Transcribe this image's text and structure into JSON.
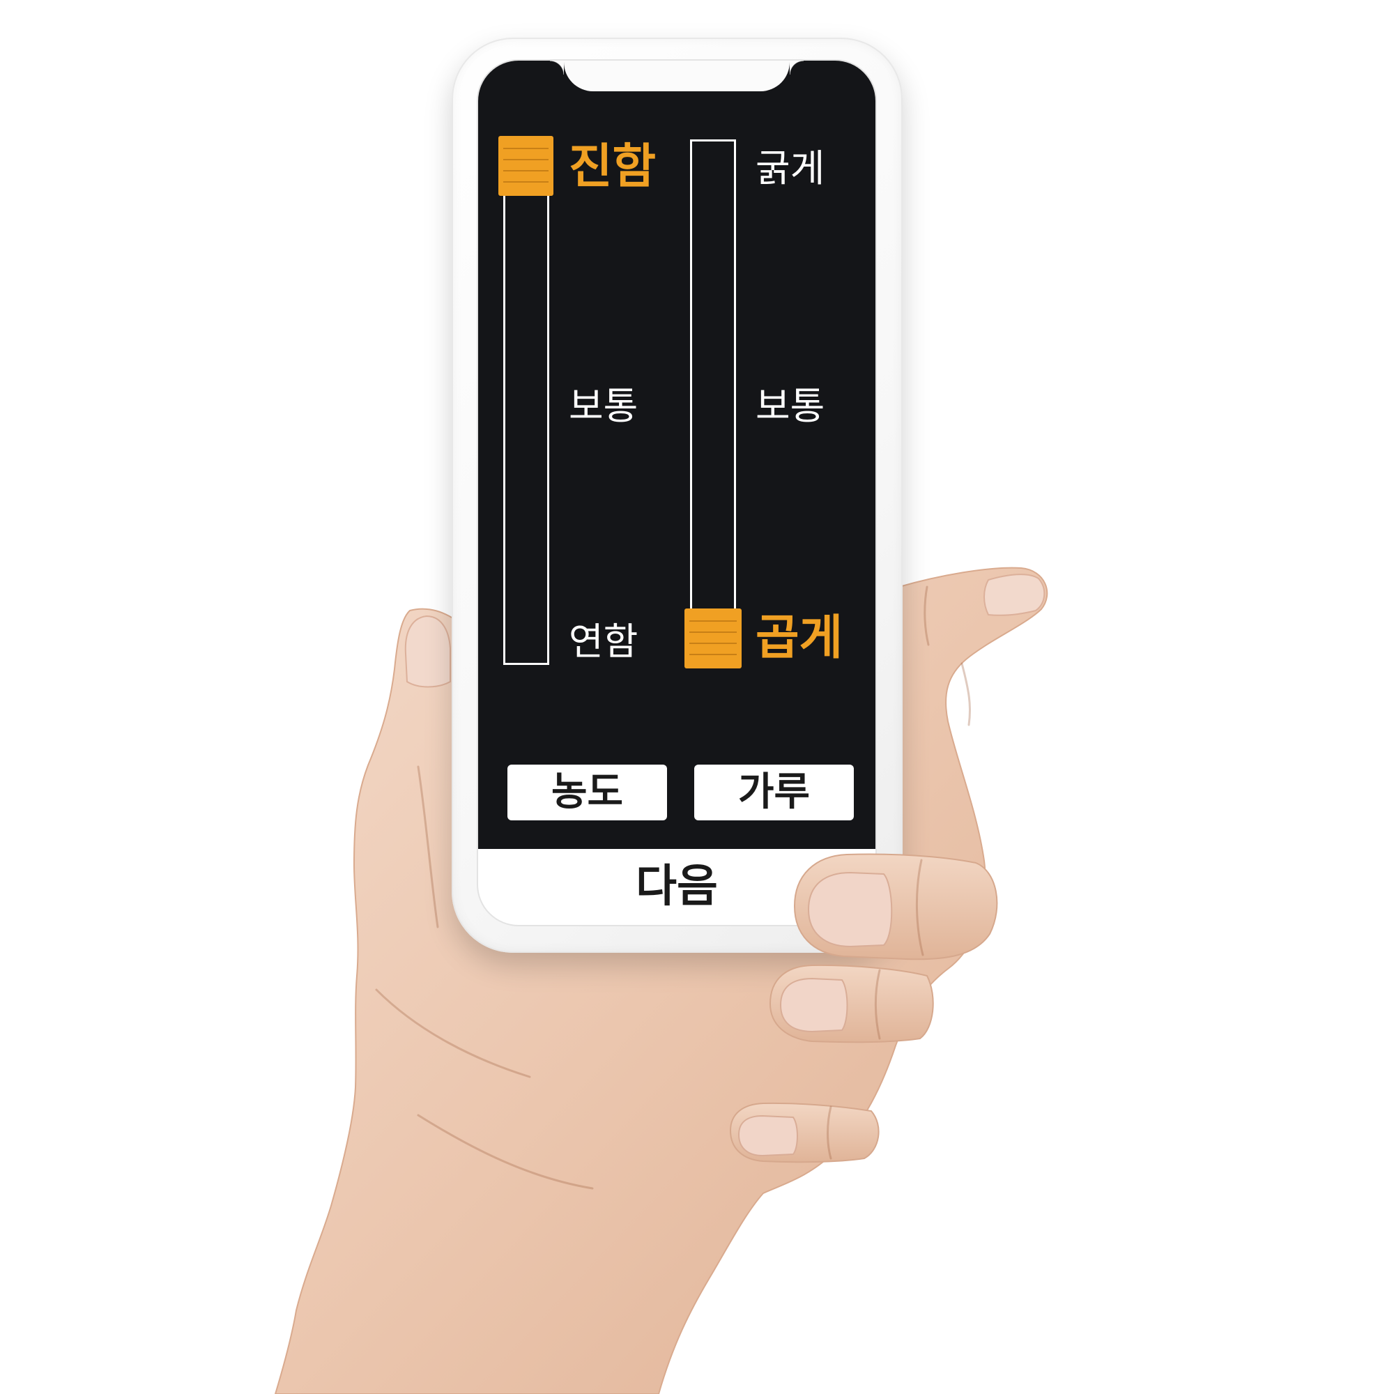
{
  "colors": {
    "accent": "#F0A023",
    "screen_background": "#141518",
    "label_text": "#FFFFFF",
    "button_text": "#1A1A1A"
  },
  "sliders": {
    "left": {
      "labels": [
        "진함",
        "보통",
        "연함"
      ],
      "selected_index": 0,
      "level": 1.0
    },
    "right": {
      "labels": [
        "굵게",
        "보통",
        "곱게"
      ],
      "selected_index": 2,
      "level": 0.0
    }
  },
  "buttons": {
    "left_label": "농도",
    "right_label": "가루"
  },
  "bottom_bar": {
    "next_label": "다음"
  },
  "icons": {
    "slider_handle": "grip-lines-icon"
  }
}
